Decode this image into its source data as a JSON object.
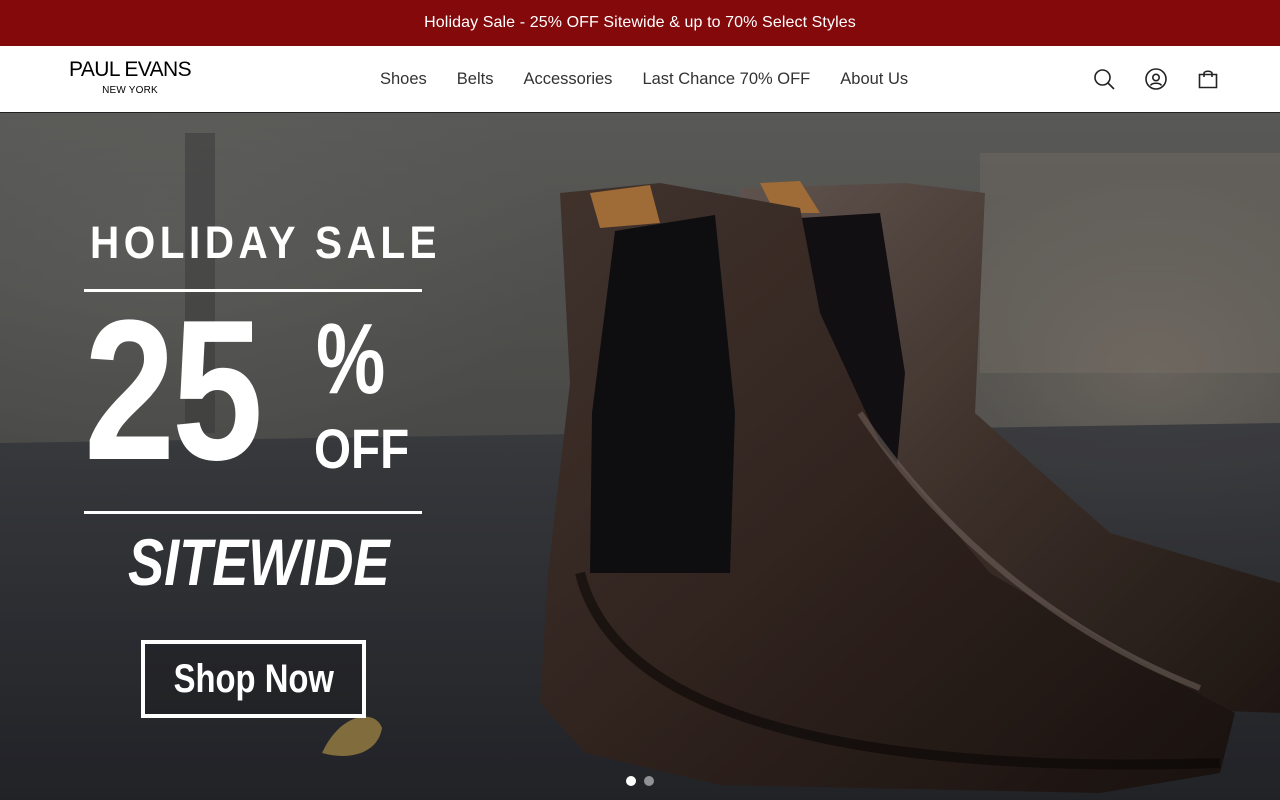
{
  "announcement": {
    "text": "Holiday Sale - 25% OFF Sitewide & up to 70% Select Styles"
  },
  "logo": {
    "name": "PAUL EVANS",
    "tagline": "NEW YORK"
  },
  "nav": {
    "items": [
      {
        "label": "Shoes"
      },
      {
        "label": "Belts"
      },
      {
        "label": "Accessories"
      },
      {
        "label": "Last Chance 70% OFF"
      },
      {
        "label": "About Us"
      }
    ]
  },
  "header_icons": [
    "search-icon",
    "account-icon",
    "cart-icon"
  ],
  "hero": {
    "title": "HOLIDAY SALE",
    "discount_number": "25",
    "discount_symbol": "%",
    "discount_suffix": "OFF",
    "scope": "SITEWIDE",
    "cta_label": "Shop Now",
    "slide_count": 2,
    "active_slide": 1
  },
  "colors": {
    "announcement_bg": "#83090b",
    "hero_text": "#ffffff",
    "boot_leather": "#3a2a24"
  }
}
